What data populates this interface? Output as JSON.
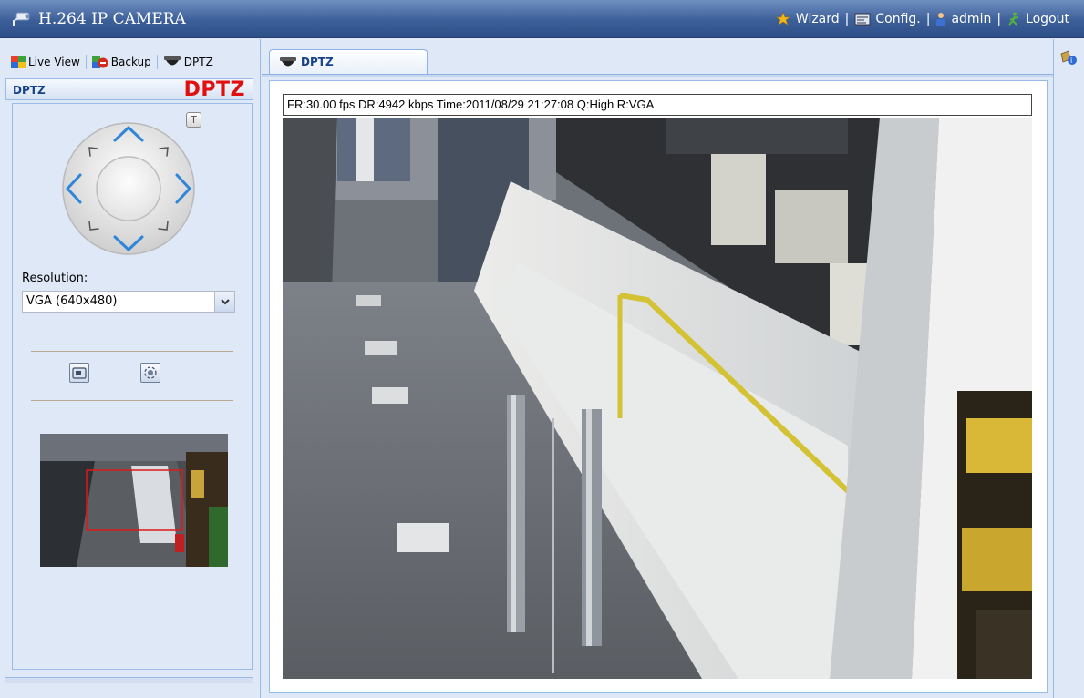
{
  "header": {
    "title": "H.264 IP CAMERA",
    "nav": [
      {
        "label": "Wizard",
        "icon": "wizard-star-icon"
      },
      {
        "label": "Config.",
        "icon": "config-icon"
      },
      {
        "label": "admin",
        "icon": "user-icon"
      },
      {
        "label": "Logout",
        "icon": "logout-icon"
      }
    ]
  },
  "left_tabs": [
    {
      "label": "Live View",
      "icon": "live-view-icon"
    },
    {
      "label": "Backup",
      "icon": "backup-icon"
    },
    {
      "label": "DPTZ",
      "icon": "dome-camera-icon"
    }
  ],
  "dptz_panel": {
    "title": "DPTZ",
    "logo": "DPTZ",
    "t_button": "T",
    "resolution_label": "Resolution:",
    "resolution_value": "VGA (640x480)"
  },
  "main": {
    "tab_label": "DPTZ",
    "status": "FR:30.00 fps  DR:4942 kbps Time:2011/08/29 21:27:08 Q:High R:VGA"
  },
  "colors": {
    "header": "#3c5f99",
    "panel_bg": "#dfe8f6",
    "border": "#99bbe8",
    "accent_text": "#15428b",
    "logo_red": "#e01010"
  }
}
